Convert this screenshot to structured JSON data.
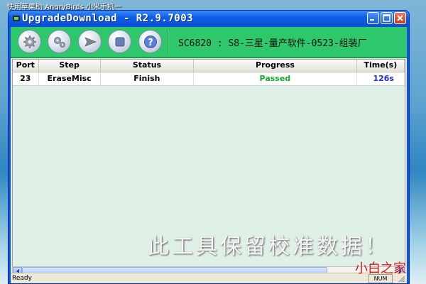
{
  "desktop": {
    "top_label": "快用苹果助 AngryBirds 小米手机一"
  },
  "window": {
    "title": "UpgradeDownload - R2.9.7003"
  },
  "toolbar": {
    "buttons": [
      "settings",
      "advanced-settings",
      "start",
      "stop",
      "help"
    ],
    "device_info": "SC6820 : S8-三星-量产软件-0523-组装厂"
  },
  "grid": {
    "columns": [
      "Port",
      "Step",
      "Status",
      "Progress",
      "Time(s)"
    ],
    "rows": [
      {
        "port": "23",
        "step": "EraseMisc",
        "status": "Finish",
        "progress": "Passed",
        "time": "126s"
      }
    ]
  },
  "statusbar": {
    "text": "Ready",
    "num": "NUM"
  },
  "overlay": {
    "watermark": "此工具保留校准数据！",
    "corner_logo": "小白之家"
  },
  "colors": {
    "toolbar_bg": "#2ec76c",
    "passed": "#19a830",
    "time": "#1a2ed0",
    "titlebar": "#0a4fd6"
  }
}
